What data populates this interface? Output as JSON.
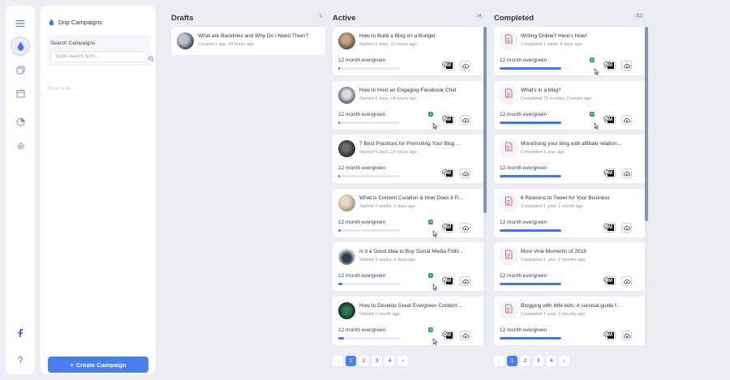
{
  "sidebar": {
    "title": "Drip Campaigns",
    "search_label": "Search Campaigns",
    "search_placeholder": "Enter search term...",
    "show_tests": "Show tests",
    "create_label": "Create Campaign"
  },
  "columns": {
    "drafts": {
      "title": "Drafts",
      "count": "1",
      "cards": [
        {
          "title": "What are Backlinks and Why Do I Need Them?",
          "meta": "Created 1 day, 19 hours ago"
        }
      ]
    },
    "active": {
      "title": "Active",
      "count": "34",
      "cards": [
        {
          "title": "How to Build a Blog on a Budget",
          "meta": "Started 6 days, 13 hours ago",
          "evergreen": "12 month evergreen",
          "progress": 0.02,
          "badge": ""
        },
        {
          "title": "How to Host an Engaging Facebook Chat",
          "meta": "Started 6 days, 14 hours ago",
          "evergreen": "12 month evergreen",
          "progress": 0.02,
          "badge": "8"
        },
        {
          "title": "7 Best Practices for Promoting Your Blog ...",
          "meta": "Started 6 days, 14 hours ago",
          "evergreen": "12 month evergreen",
          "progress": 0.02,
          "badge": ""
        },
        {
          "title": "What is Content Curation & How Does it Fi...",
          "meta": "Started 2 weeks, 2 days ago",
          "evergreen": "12 month evergreen",
          "progress": 0.04,
          "badge": "16"
        },
        {
          "title": "Is it a Good Idea to Buy Social Media Follo...",
          "meta": "Started 3 weeks, 4 days ago",
          "evergreen": "12 month evergreen",
          "progress": 0.06,
          "badge": "2"
        },
        {
          "title": "How to Develop Great Evergreen Content ...",
          "meta": "Started 1 month ago",
          "evergreen": "12 month evergreen",
          "progress": 0.09,
          "badge": "18"
        }
      ]
    },
    "completed": {
      "title": "Completed",
      "count": "113",
      "cards": [
        {
          "title": "Writing Online? Here's How!",
          "meta": "Completed 1 week, 5 days ago",
          "evergreen": "12 month evergreen",
          "progress": 1,
          "badge": "10"
        },
        {
          "title": "What's in a blog?",
          "meta": "Completed 11 months, 3 weeks ago",
          "evergreen": "12 month evergreen",
          "progress": 1,
          "badge": "12"
        },
        {
          "title": "Monetising your blog with affiliate relation...",
          "meta": "Completed 1 year ago",
          "evergreen": "12 month evergreen",
          "progress": 1,
          "badge": ""
        },
        {
          "title": "8 Reasons to Tweet for Your Business",
          "meta": "Completed 1 year, 1 month ago",
          "evergreen": "12 month evergreen",
          "progress": 1,
          "badge": ""
        },
        {
          "title": "Most Viral Moments of 2018",
          "meta": "Completed 1 year, 2 months ago",
          "evergreen": "12 month evergreen",
          "progress": 1,
          "badge": ""
        },
        {
          "title": "Blogging with little kids: A survival guide f...",
          "meta": "Completed 1 year, 2 months ago",
          "evergreen": "12 month evergreen",
          "progress": 1,
          "badge": ""
        }
      ]
    }
  },
  "pagination": {
    "prev": "‹",
    "pages": [
      "1",
      "2",
      "3",
      "4"
    ],
    "next": "›",
    "current": "1"
  },
  "icons": {
    "menu": "menu-icon",
    "drip": "drop-icon",
    "copy": "copy-icon",
    "calendar": "calendar-icon",
    "chart": "pie-chart-icon",
    "settings": "gear-icon",
    "facebook": "facebook-icon",
    "help": "help-icon",
    "medium": "medium-icon",
    "cloud": "cloud-download-icon"
  },
  "colors": {
    "accent": "#4b7ef0",
    "badge": "#22a35a",
    "doc": "#e25c8d"
  }
}
